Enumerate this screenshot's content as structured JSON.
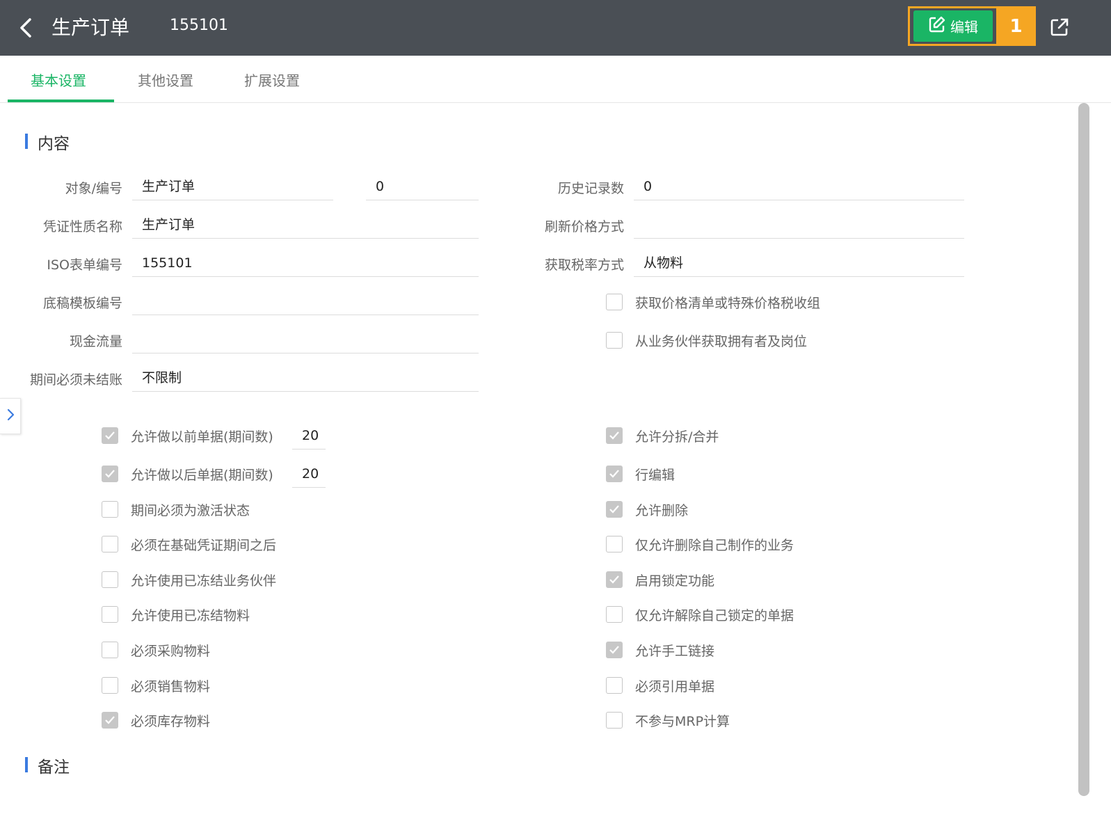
{
  "header": {
    "title": "生产订单",
    "order_no": "155101",
    "edit_label": "编辑",
    "step_badge": "1"
  },
  "tabs": [
    {
      "label": "基本设置",
      "active": true
    },
    {
      "label": "其他设置",
      "active": false
    },
    {
      "label": "扩展设置",
      "active": false
    }
  ],
  "sections": {
    "content": "内容",
    "notes": "备注"
  },
  "form_left": {
    "object_no": {
      "label": "对象/编号",
      "value": "生产订单",
      "value2": "0"
    },
    "voucher_name": {
      "label": "凭证性质名称",
      "value": "生产订单"
    },
    "iso_no": {
      "label": "ISO表单编号",
      "value": "155101"
    },
    "draft_template": {
      "label": "底稿模板编号",
      "value": ""
    },
    "cash_flow": {
      "label": "现金流量",
      "value": ""
    },
    "period_unclosed": {
      "label": "期间必须未结账",
      "value": "不限制"
    }
  },
  "form_right": {
    "history_count": {
      "label": "历史记录数",
      "value": "0"
    },
    "refresh_price": {
      "label": "刷新价格方式",
      "value": ""
    },
    "tax_rate_method": {
      "label": "获取税率方式",
      "value": "从物料"
    }
  },
  "checks_right_top": [
    {
      "label": "获取价格清单或特殊价格税收组",
      "checked": false
    },
    {
      "label": "从业务伙伴获取拥有者及岗位",
      "checked": false
    }
  ],
  "checks_left": [
    {
      "label": "允许做以前单据(期间数)",
      "checked": true,
      "value": "20"
    },
    {
      "label": "允许做以后单据(期间数)",
      "checked": true,
      "value": "20"
    },
    {
      "label": "期间必须为激活状态",
      "checked": false
    },
    {
      "label": "必须在基础凭证期间之后",
      "checked": false
    },
    {
      "label": "允许使用已冻结业务伙伴",
      "checked": false
    },
    {
      "label": "允许使用已冻结物料",
      "checked": false
    },
    {
      "label": "必须采购物料",
      "checked": false
    },
    {
      "label": "必须销售物料",
      "checked": false
    },
    {
      "label": "必须库存物料",
      "checked": true
    }
  ],
  "checks_right": [
    {
      "label": "允许分拆/合并",
      "checked": true
    },
    {
      "label": "行编辑",
      "checked": true
    },
    {
      "label": "允许删除",
      "checked": true
    },
    {
      "label": "仅允许删除自己制作的业务",
      "checked": false
    },
    {
      "label": "启用锁定功能",
      "checked": true
    },
    {
      "label": "仅允许解除自己锁定的单据",
      "checked": false
    },
    {
      "label": "允许手工链接",
      "checked": true
    },
    {
      "label": "必须引用单据",
      "checked": false
    },
    {
      "label": "不参与MRP计算",
      "checked": false
    }
  ]
}
